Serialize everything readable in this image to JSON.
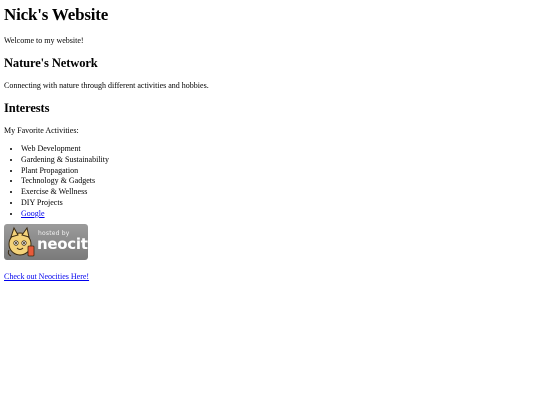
{
  "header": {
    "title": "Nick's Website",
    "welcome": "Welcome to my website!"
  },
  "network": {
    "heading": "Nature's Network",
    "description": "Connecting with nature through different activities and hobbies."
  },
  "interests": {
    "heading": "Interests",
    "intro": "My Favorite Activities:",
    "items": [
      "Web Development",
      "Gardening & Sustainability",
      "Plant Propagation",
      "Technology & Gadgets",
      "Exercise & Wellness",
      "DIY Projects"
    ],
    "link_label": "Google"
  },
  "badge": {
    "small_text": "hosted by",
    "big_text": "neocities",
    "colors": {
      "background": "#8a8a8a",
      "text": "#ffffff"
    }
  },
  "footer": {
    "link_label": "Check out Neocities Here!"
  },
  "colors": {
    "link": "#0000ee",
    "text": "#000000",
    "background": "#ffffff"
  }
}
